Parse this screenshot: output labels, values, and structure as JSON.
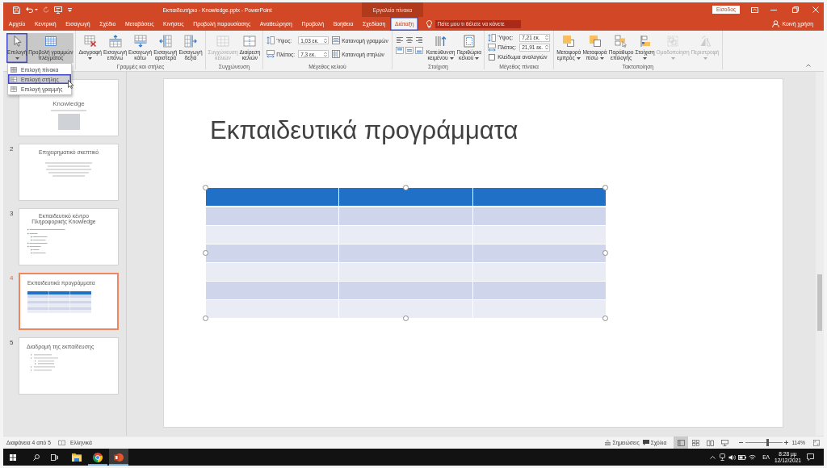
{
  "window": {
    "title": "Εκπαιδευτήριο - Knowledge.pptx - PowerPoint",
    "context_header": "Εργαλεία πίνακα",
    "sign_in": "Είσοδος"
  },
  "tabs": [
    {
      "label": "Αρχείο",
      "selected": false,
      "highlighted": false
    },
    {
      "label": "Κεντρική",
      "selected": false,
      "highlighted": false
    },
    {
      "label": "Εισαγωγή",
      "selected": false,
      "highlighted": false
    },
    {
      "label": "Σχέδιο",
      "selected": false,
      "highlighted": false
    },
    {
      "label": "Μεταβάσεις",
      "selected": false,
      "highlighted": false
    },
    {
      "label": "Κινήσεις",
      "selected": false,
      "highlighted": false
    },
    {
      "label": "Προβολή παρουσίασης",
      "selected": false,
      "highlighted": false
    },
    {
      "label": "Αναθεώρηση",
      "selected": false,
      "highlighted": false
    },
    {
      "label": "Προβολή",
      "selected": false,
      "highlighted": false
    },
    {
      "label": "Βοήθεια",
      "selected": false,
      "highlighted": false
    },
    {
      "label": "Σχεδίαση",
      "selected": false,
      "highlighted": false
    },
    {
      "label": "Διάταξη",
      "selected": true,
      "highlighted": true
    }
  ],
  "tell_me": {
    "placeholder": "Πείτε μου τι θέλετε να κάνετε",
    "highlighted": true
  },
  "share": "Κοινή χρήση",
  "ribbon": {
    "groups": [
      {
        "items": [
          {
            "kind": "large",
            "label": "Επιλογή",
            "dropdown": true,
            "pressed": true,
            "highlighted": true,
            "disabled": false
          },
          {
            "kind": "large",
            "label": "Προβολή γραμμών\nπλέγματος",
            "dropdown": false,
            "pressed": true,
            "highlighted": false,
            "disabled": false
          }
        ]
      },
      {
        "label": "Γραμμές και στήλες",
        "items": [
          {
            "kind": "large",
            "label": "Διαγραφή",
            "dropdown": true,
            "pressed": false,
            "highlighted": false,
            "disabled": false
          },
          {
            "kind": "large",
            "label": "Εισαγωγή\nεπάνω",
            "dropdown": false,
            "pressed": false,
            "highlighted": false,
            "disabled": false
          },
          {
            "kind": "large",
            "label": "Εισαγωγή\nκάτω",
            "dropdown": false,
            "pressed": false,
            "highlighted": false,
            "disabled": false
          },
          {
            "kind": "large",
            "label": "Εισαγωγή\nαριστερά",
            "dropdown": false,
            "pressed": false,
            "highlighted": false,
            "disabled": false
          },
          {
            "kind": "large",
            "label": "Εισαγωγή\nδεξιά",
            "dropdown": false,
            "pressed": false,
            "highlighted": false,
            "disabled": false
          }
        ]
      },
      {
        "label": "Συγχώνευση",
        "items": [
          {
            "kind": "large",
            "label": "Συγχώνευση\nκελιών",
            "dropdown": false,
            "pressed": false,
            "highlighted": false,
            "disabled": true
          },
          {
            "kind": "large",
            "label": "Διαίρεση\nκελιών",
            "dropdown": false,
            "pressed": false,
            "highlighted": false,
            "disabled": false
          }
        ]
      },
      {
        "label": "Μέγεθος κελιού",
        "items": [
          {
            "kind": "stack",
            "rows": [
              {
                "kind": "spin",
                "label": "Ύψος:",
                "value": "1,03 εκ."
              },
              {
                "kind": "spin",
                "label": "Πλάτος:",
                "value": "7,3 εκ."
              }
            ]
          },
          {
            "kind": "stack",
            "rows": [
              {
                "kind": "small",
                "label": "Κατανομή γραμμών"
              },
              {
                "kind": "small",
                "label": "Κατανομή στηλών"
              }
            ]
          }
        ]
      },
      {
        "label": "Στοίχιση",
        "items": [
          {
            "kind": "align"
          },
          {
            "kind": "large",
            "label": "Κατεύθυνση\nκειμένου",
            "dropdown": true,
            "pressed": false,
            "highlighted": false,
            "disabled": false
          },
          {
            "kind": "large",
            "label": "Περιθώρια\nκελιού",
            "dropdown": true,
            "pressed": false,
            "highlighted": false,
            "disabled": false
          }
        ]
      },
      {
        "label": "Μέγεθος πίνακα",
        "items": [
          {
            "kind": "stack",
            "rows": [
              {
                "kind": "spin",
                "label": "Ύψος:",
                "value": "7,21 εκ."
              },
              {
                "kind": "spin",
                "label": "Πλάτος:",
                "value": "21,91 εκ."
              },
              {
                "kind": "checkbox",
                "label": "Κλείδωμα αναλογιών",
                "checked": false
              }
            ]
          }
        ]
      },
      {
        "label": "Τακτοποίηση",
        "items": [
          {
            "kind": "large",
            "label": "Μεταφορά\nεμπρός",
            "dropdown": true,
            "pressed": false,
            "highlighted": false,
            "disabled": false
          },
          {
            "kind": "large",
            "label": "Μεταφορά\nπίσω",
            "dropdown": true,
            "pressed": false,
            "highlighted": false,
            "disabled": false
          },
          {
            "kind": "large",
            "label": "Παράθυρο\nεπιλογής",
            "dropdown": false,
            "pressed": false,
            "highlighted": false,
            "disabled": false
          },
          {
            "kind": "large",
            "label": "Στοίχιση",
            "dropdown": true,
            "pressed": false,
            "highlighted": false,
            "disabled": false
          },
          {
            "kind": "large",
            "label": "Ομαδοποίηση",
            "dropdown": true,
            "pressed": false,
            "highlighted": false,
            "disabled": true
          },
          {
            "kind": "large",
            "label": "Περιστροφή",
            "dropdown": true,
            "pressed": false,
            "highlighted": false,
            "disabled": true
          }
        ]
      }
    ]
  },
  "select_menu": {
    "items": [
      {
        "label": "Επιλογή πίνακα",
        "selected": false
      },
      {
        "label": "Επιλογή στήλης",
        "selected": true
      },
      {
        "label": "Επιλογή γραμμής",
        "selected": false
      }
    ]
  },
  "slides": [
    {
      "kind": "title",
      "title": "Knowledge",
      "selected": false
    },
    {
      "number": "2",
      "kind": "text",
      "title": "Επιχειρηματικό σκεπτικό",
      "selected": false
    },
    {
      "number": "3",
      "kind": "bullets",
      "title": "Εκπαιδευτικό κέντρο\nΠληροφορικής Knowledge",
      "selected": false
    },
    {
      "number": "4",
      "kind": "table",
      "title": "Εκπαιδευτικά προγράμματα",
      "selected": true
    },
    {
      "number": "5",
      "kind": "list",
      "title": "Διαδρομή της εκπαίδευσης",
      "selected": false
    }
  ],
  "slide": {
    "title": "Εκπαιδευτικά προγράμματα",
    "table": {
      "selected": true,
      "rows": [
        {
          "kind": "header",
          "cells": [
            {
              "kind": "empty"
            },
            {
              "kind": "empty"
            },
            {
              "kind": "empty"
            }
          ]
        },
        {
          "kind": "band",
          "cells": [
            {
              "kind": "empty"
            },
            {
              "kind": "empty"
            },
            {
              "kind": "empty"
            }
          ]
        },
        {
          "kind": "plain",
          "cells": [
            {
              "kind": "empty"
            },
            {
              "kind": "empty"
            },
            {
              "kind": "empty"
            }
          ]
        },
        {
          "kind": "band",
          "cells": [
            {
              "kind": "empty"
            },
            {
              "kind": "empty"
            },
            {
              "kind": "empty"
            }
          ]
        },
        {
          "kind": "plain",
          "cells": [
            {
              "kind": "empty"
            },
            {
              "kind": "empty"
            },
            {
              "kind": "empty"
            }
          ]
        },
        {
          "kind": "band",
          "cells": [
            {
              "kind": "empty"
            },
            {
              "kind": "empty"
            },
            {
              "kind": "empty"
            }
          ]
        },
        {
          "kind": "plain",
          "cells": [
            {
              "kind": "empty"
            },
            {
              "kind": "empty"
            },
            {
              "kind": "empty"
            }
          ]
        }
      ]
    }
  },
  "status_bar": {
    "slide_position": "Διαφάνεια 4 από 5",
    "language": "Ελληνικά",
    "notes": "Σημειώσεις",
    "comments": "Σχόλια",
    "views": [
      {
        "kind": "normal",
        "selected": true
      },
      {
        "kind": "sorter",
        "selected": false
      },
      {
        "kind": "reading",
        "selected": false
      },
      {
        "kind": "slideshow",
        "selected": false
      }
    ],
    "zoom": {
      "level": 0.58,
      "reading": "114%"
    }
  },
  "taskbar": {
    "apps": [
      {
        "kind": "explorer",
        "running": false,
        "active": false
      },
      {
        "kind": "chrome",
        "running": true,
        "active": false
      },
      {
        "kind": "powerpoint",
        "running": true,
        "active": true
      }
    ],
    "input_language": "ΕΛ",
    "time": "8:28 μμ",
    "date": "12/12/2021"
  }
}
